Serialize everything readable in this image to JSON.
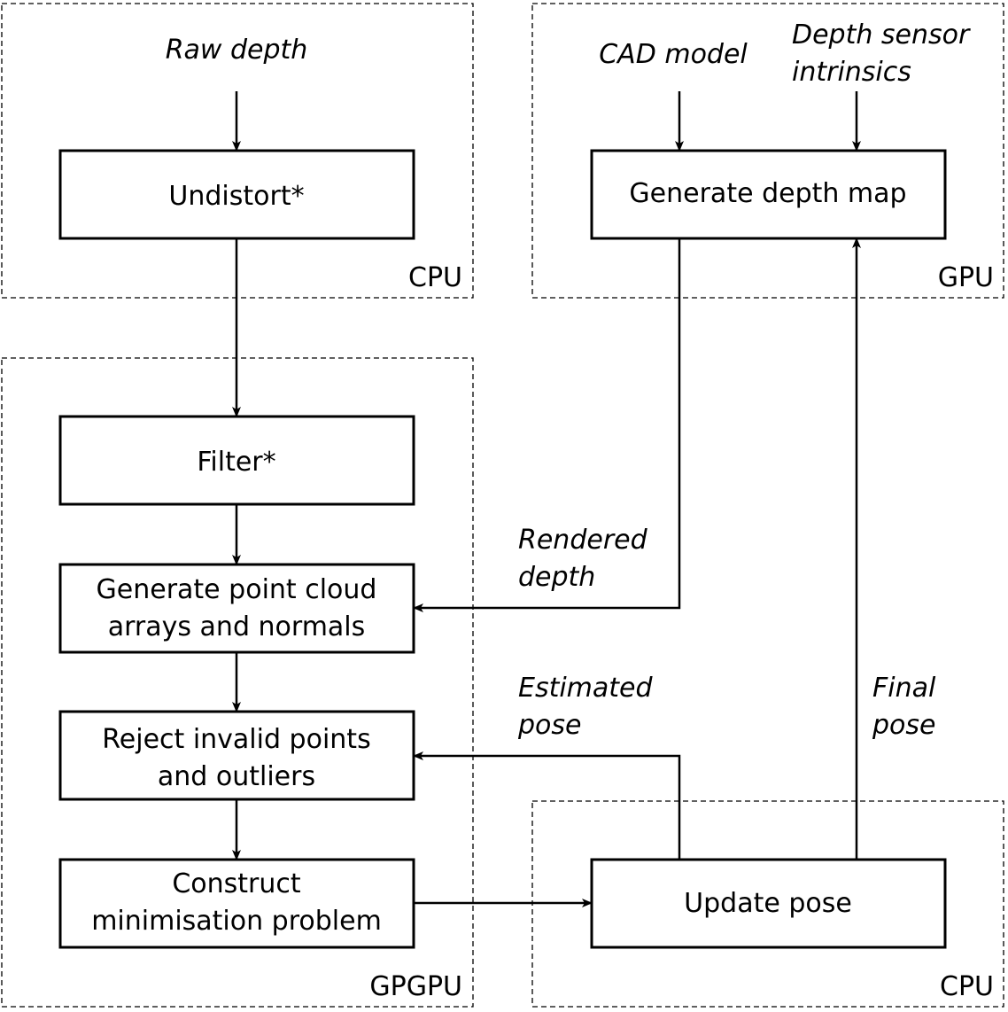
{
  "groups": {
    "cpu_top": "CPU",
    "gpu": "GPU",
    "gpgpu": "GPGPU",
    "cpu_bottom": "CPU"
  },
  "inputs": {
    "raw_depth": "Raw depth",
    "cad_model": "CAD model",
    "depth_sensor_line1": "Depth sensor",
    "depth_sensor_line2": "intrinsics"
  },
  "boxes": {
    "undistort": "Undistort*",
    "filter": "Filter*",
    "point_cloud_line1": "Generate point cloud",
    "point_cloud_line2": "arrays and normals",
    "reject_line1": "Reject invalid points",
    "reject_line2": "and outliers",
    "construct_line1": "Construct",
    "construct_line2": "minimisation problem",
    "depth_map": "Generate depth map",
    "update_pose": "Update pose"
  },
  "edges": {
    "rendered_line1": "Rendered",
    "rendered_line2": "depth",
    "estimated_line1": "Estimated",
    "estimated_line2": "pose",
    "final_line1": "Final",
    "final_line2": "pose"
  }
}
